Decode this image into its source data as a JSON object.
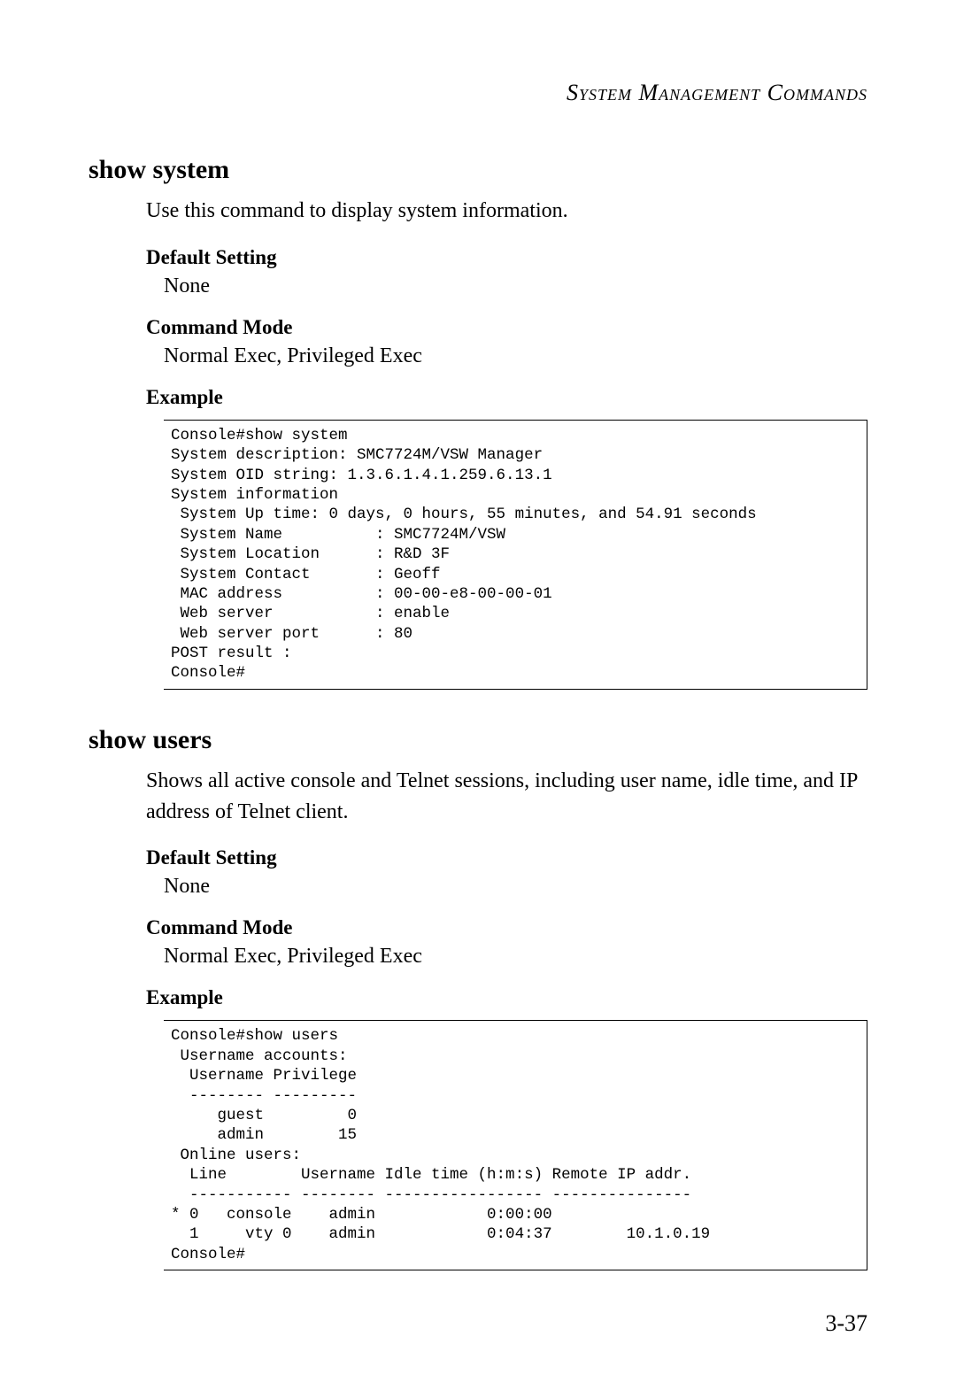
{
  "header": "System Management Commands",
  "section1": {
    "title": "show system",
    "description": "Use this command to display system information.",
    "default_setting_label": "Default Setting",
    "default_setting_value": "None",
    "command_mode_label": "Command Mode",
    "command_mode_value": "Normal Exec, Privileged Exec",
    "example_label": "Example",
    "example_code": "Console#show system\nSystem description: SMC7724M/VSW Manager\nSystem OID string: 1.3.6.1.4.1.259.6.13.1\nSystem information\n System Up time: 0 days, 0 hours, 55 minutes, and 54.91 seconds\n System Name          : SMC7724M/VSW\n System Location      : R&D 3F\n System Contact       : Geoff\n MAC address          : 00-00-e8-00-00-01\n Web server           : enable\n Web server port      : 80\nPOST result :\nConsole#"
  },
  "section2": {
    "title": "show users",
    "description": "Shows all active console and Telnet sessions, including user name, idle time, and IP address of Telnet client.",
    "default_setting_label": "Default Setting",
    "default_setting_value": "None",
    "command_mode_label": "Command Mode",
    "command_mode_value": "Normal Exec, Privileged Exec",
    "example_label": "Example",
    "example_code": "Console#show users\n Username accounts:\n  Username Privilege\n  -------- ---------\n     guest         0\n     admin        15\n Online users:\n  Line        Username Idle time (h:m:s) Remote IP addr.\n  ----------- -------- ----------------- ---------------\n* 0   console    admin            0:00:00\n  1     vty 0    admin            0:04:37        10.1.0.19\nConsole#"
  },
  "page_number": "3-37"
}
